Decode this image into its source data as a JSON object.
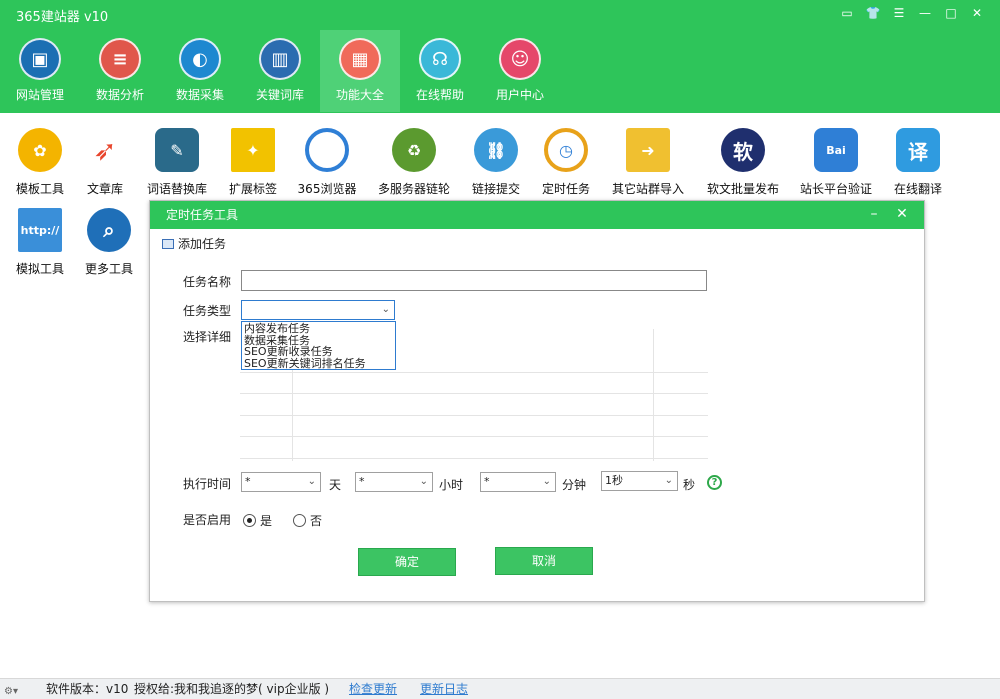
{
  "app": {
    "title": "365建站器 v10",
    "window_controls": [
      "message-icon",
      "shirt-icon",
      "menu-icon",
      "minimize-icon",
      "maximize-icon",
      "close-icon"
    ]
  },
  "nav": {
    "active": "功能大全",
    "items": [
      {
        "label": "网站管理",
        "icon": "monitor-icon",
        "color": "#1b6fb3"
      },
      {
        "label": "数据分析",
        "icon": "database-icon",
        "color": "#e0574b"
      },
      {
        "label": "数据采集",
        "icon": "globe-icon",
        "color": "#1e88d0"
      },
      {
        "label": "关键词库",
        "icon": "book-icon",
        "color": "#2b6cb0"
      },
      {
        "label": "功能大全",
        "icon": "grid-icon",
        "color": "#f06a5a"
      },
      {
        "label": "在线帮助",
        "icon": "headset-icon",
        "color": "#3ab8d8"
      },
      {
        "label": "用户中心",
        "icon": "user-icon",
        "color": "#e5476a"
      }
    ]
  },
  "tools": [
    {
      "label": "模板工具",
      "icon": "palette-icon",
      "color": "#f4b400"
    },
    {
      "label": "文章库",
      "icon": "runner-icon",
      "color": "#e8452c"
    },
    {
      "label": "词语替换库",
      "icon": "feather-icon",
      "color": "#2a6a8a"
    },
    {
      "label": "扩展标签",
      "icon": "pin-icon",
      "color": "#f2c200"
    },
    {
      "label": "365浏览器",
      "icon": "browser-icon",
      "color": "#2f7fd6"
    },
    {
      "label": "多服务器链轮",
      "icon": "recycle-icon",
      "color": "#5b9a2f"
    },
    {
      "label": "链接提交",
      "icon": "link-icon",
      "color": "#3a9ad9"
    },
    {
      "label": "定时任务",
      "icon": "clock-icon",
      "color": "#e8a21a"
    },
    {
      "label": "其它站群导入",
      "icon": "folder-icon",
      "color": "#f0c030"
    },
    {
      "label": "软文批量发布",
      "icon": "soft-icon",
      "color": "#1f2f6e",
      "glyph": "软"
    },
    {
      "label": "站长平台验证",
      "icon": "baidu-icon",
      "color": "#2f7fd6",
      "glyph": "Bai"
    },
    {
      "label": "在线翻译",
      "icon": "translate-icon",
      "color": "#2f9be0",
      "glyph": "译"
    },
    {
      "label": "模拟工具",
      "icon": "http-icon",
      "color": "#3a8fd9",
      "glyph": "http://"
    },
    {
      "label": "更多工具",
      "icon": "search-icon",
      "color": "#1f6fb8"
    }
  ],
  "dialog": {
    "title": "定时任务工具",
    "add_task": "添加任务",
    "task_name_label": "任务名称",
    "task_name_value": "",
    "task_type_label": "任务类型",
    "task_type_value": "",
    "task_type_options": [
      "内容发布任务",
      "数据采集任务",
      "SEO更新收录任务",
      "SEO更新关键词排名任务"
    ],
    "detail_label": "选择详细",
    "exec_time_label": "执行时间",
    "day_value": "*",
    "day_unit": "天",
    "hour_value": "*",
    "hour_unit": "小时",
    "minute_value": "*",
    "minute_unit": "分钟",
    "second_value": "1秒",
    "second_unit": "秒",
    "enable_label": "是否启用",
    "enable_yes": "是",
    "enable_no": "否",
    "enable_selected": "是",
    "ok": "确定",
    "cancel": "取消"
  },
  "status": {
    "version": "软件版本：v10",
    "license": "授权给:我和我追逐的梦( vip企业版 )",
    "check_update": "检查更新",
    "update_log": "更新日志"
  }
}
